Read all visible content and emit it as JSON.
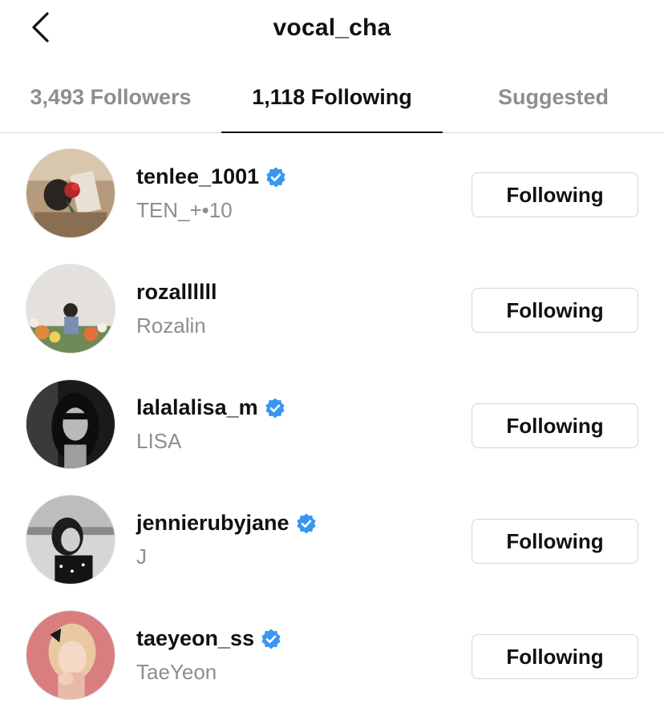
{
  "header": {
    "title": "vocal_cha",
    "back_icon": "chevron-left-icon"
  },
  "tabs": [
    {
      "label": "3,493 Followers",
      "active": false
    },
    {
      "label": "1,118 Following",
      "active": true
    },
    {
      "label": "Suggested",
      "active": false
    }
  ],
  "accounts": [
    {
      "username": "tenlee_1001",
      "full_name": "TEN_+•10",
      "verified": true,
      "button_label": "Following"
    },
    {
      "username": "rozallllll",
      "full_name": "Rozalin",
      "verified": false,
      "button_label": "Following"
    },
    {
      "username": "lalalalisa_m",
      "full_name": "LISA",
      "verified": true,
      "button_label": "Following"
    },
    {
      "username": "jennierubyjane",
      "full_name": "J",
      "verified": true,
      "button_label": "Following"
    },
    {
      "username": "taeyeon_ss",
      "full_name": "TaeYeon",
      "verified": true,
      "button_label": "Following"
    }
  ],
  "colors": {
    "verified_badge": "#3897f0",
    "secondary_text": "#8e8e8e",
    "divider": "#dbdbdb"
  }
}
